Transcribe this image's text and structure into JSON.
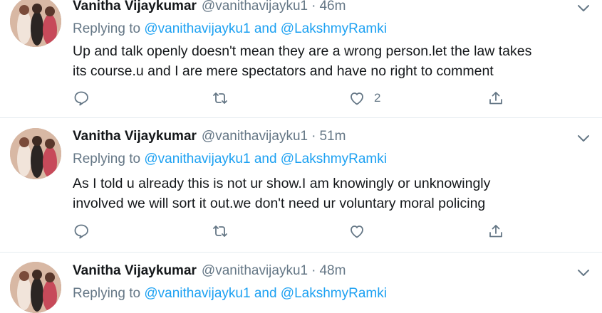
{
  "tweets": [
    {
      "name": "Vanitha Vijaykumar",
      "handle": "@vanithavijayku1",
      "dot": "·",
      "time": "46m",
      "replying_prefix": "Replying to",
      "replying_users": "@vanithavijayku1 and @LakshmyRamki",
      "text_line1": "Up and talk openly doesn't mean they are a wrong person.let the law takes",
      "text_line2": "its course.u and I are mere spectators and have no right to comment",
      "like_count": "2"
    },
    {
      "name": "Vanitha Vijaykumar",
      "handle": "@vanithavijayku1",
      "dot": "·",
      "time": "51m",
      "replying_prefix": "Replying to",
      "replying_users": "@vanithavijayku1 and @LakshmyRamki",
      "text_line1": "As I told u already this is not ur show.I am knowingly or unknowingly",
      "text_line2": "involved we will sort it out.we don't need ur voluntary moral policing",
      "like_count": ""
    },
    {
      "name": "Vanitha Vijaykumar",
      "handle": "@vanithavijayku1",
      "dot": "·",
      "time": "48m",
      "replying_prefix": "Replying to",
      "replying_users": "@vanithavijayku1 and @LakshmyRamki"
    }
  ],
  "icons": {
    "reply": "reply-icon",
    "retweet": "retweet-icon",
    "like": "like-icon",
    "share": "share-icon",
    "more": "chevron-down-icon"
  },
  "colors": {
    "name": "#14171a",
    "secondary": "#657786",
    "link": "#1da1f2",
    "divider": "#e6ecf0"
  }
}
